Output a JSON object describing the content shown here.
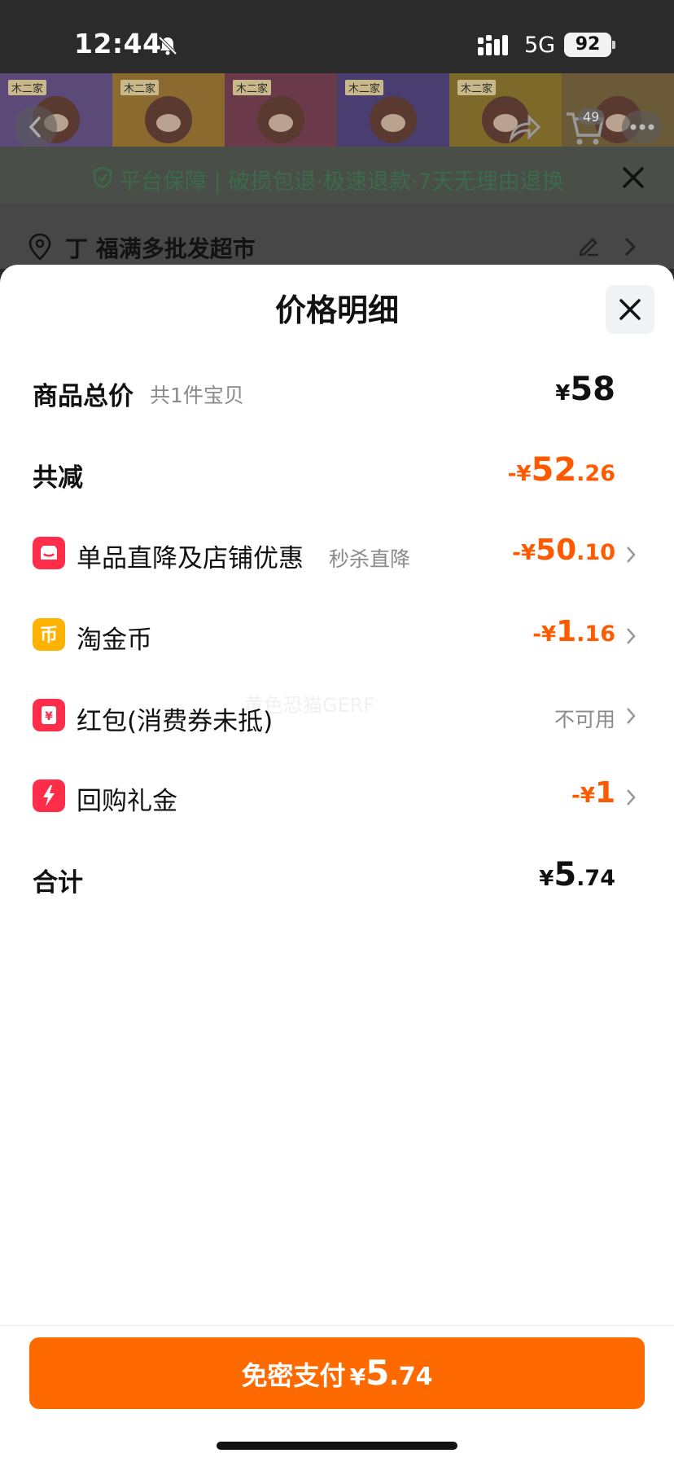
{
  "status": {
    "time": "12:44",
    "network": "5G",
    "battery": "92"
  },
  "background": {
    "guarantee": "平台保障 | 破损包退·极速退款·7天无理由退换",
    "address": "丁 福满多批发超市",
    "cart_count": "49",
    "package_brand": "木二家"
  },
  "sheet": {
    "title": "价格明细",
    "rows": {
      "total": {
        "label": "商品总价",
        "sub": "共1件宝贝",
        "currency": "¥",
        "int": "58",
        "dec": ""
      },
      "reduce": {
        "label": "共减",
        "currency": "-¥",
        "int": "52",
        "dec": ".26"
      },
      "discount": {
        "label": "单品直降及店铺优惠",
        "sub": "秒杀直降",
        "currency": "-¥",
        "int": "50",
        "dec": ".10"
      },
      "coins": {
        "label": "淘金币",
        "currency": "-¥",
        "int": "1",
        "dec": ".16"
      },
      "redpacket": {
        "label": "红包(消费券未抵)",
        "status": "不可用"
      },
      "rebuy": {
        "label": "回购礼金",
        "currency": "-¥",
        "int": "1",
        "dec": ""
      },
      "sum": {
        "label": "合计",
        "currency": "¥",
        "int": "5",
        "dec": ".74"
      }
    },
    "watermark": "黄色恐猫GERF"
  },
  "pay_button": {
    "label": "免密支付",
    "currency": "¥",
    "int": "5",
    "dec": ".74"
  },
  "colors": {
    "accent": "#ff6a00",
    "discount": "#ff5a00",
    "icon_red": "#ff2d4a",
    "icon_yellow": "#ffb300"
  }
}
